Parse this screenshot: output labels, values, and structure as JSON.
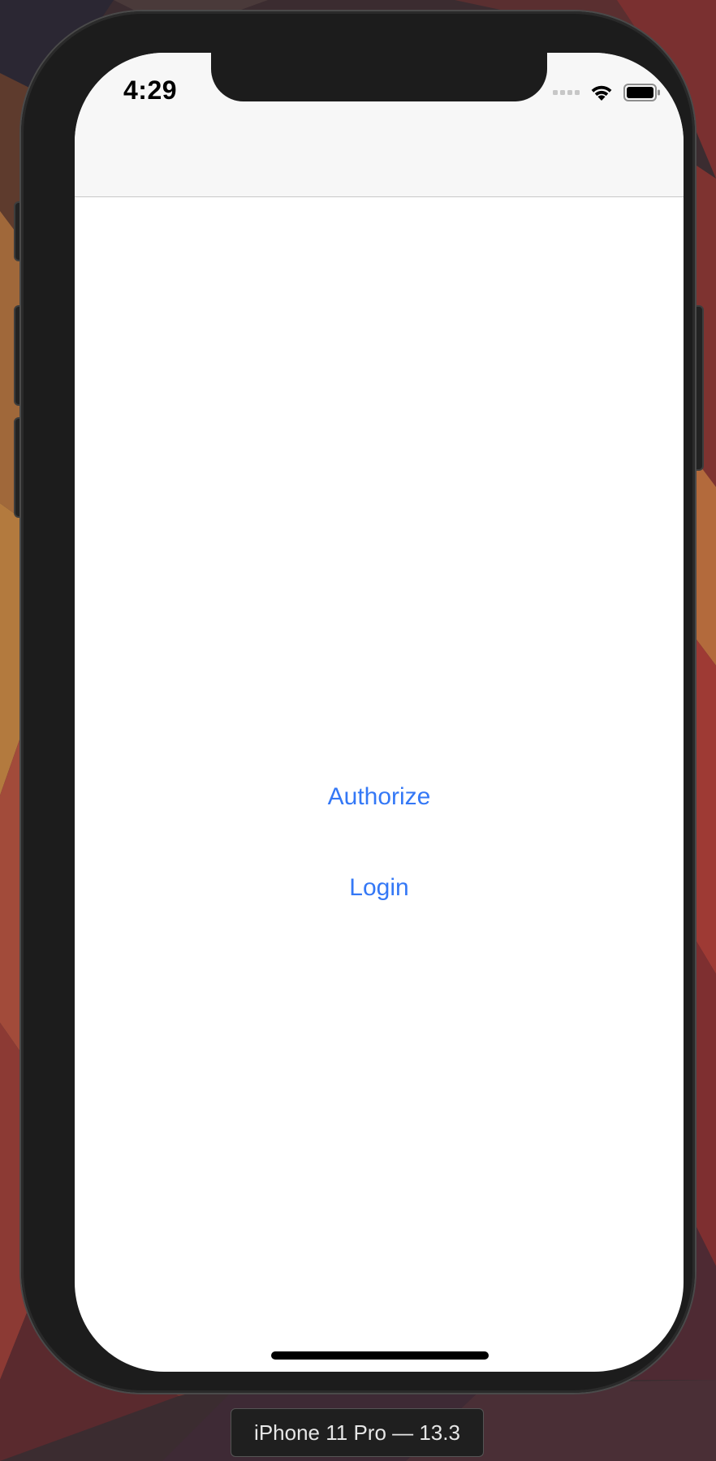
{
  "status_bar": {
    "time": "4:29"
  },
  "main": {
    "authorize_label": "Authorize",
    "login_label": "Login"
  },
  "simulator": {
    "device_label": "iPhone 11 Pro — 13.3"
  },
  "colors": {
    "accent": "#3478f6",
    "nav_background": "#f7f7f7",
    "screen_background": "#ffffff",
    "device_frame": "#1c1c1c"
  },
  "icons": [
    "cellular-signal-icon",
    "wifi-icon",
    "battery-icon"
  ]
}
